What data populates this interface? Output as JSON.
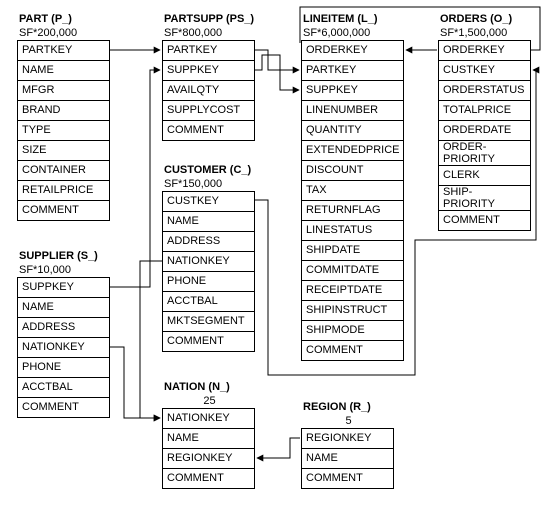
{
  "tables": {
    "part": {
      "title": "PART (P_)",
      "subtitle": "SF*200,000",
      "rows": [
        "PARTKEY",
        "NAME",
        "MFGR",
        "BRAND",
        "TYPE",
        "SIZE",
        "CONTAINER",
        "RETAILPRICE",
        "COMMENT"
      ]
    },
    "partsupp": {
      "title": "PARTSUPP (PS_)",
      "subtitle": "SF*800,000",
      "rows": [
        "PARTKEY",
        "SUPPKEY",
        "AVAILQTY",
        "SUPPLYCOST",
        "COMMENT"
      ]
    },
    "lineitem": {
      "title": "LINEITEM (L_)",
      "subtitle": "SF*6,000,000",
      "rows": [
        "ORDERKEY",
        "PARTKEY",
        "SUPPKEY",
        "LINENUMBER",
        "QUANTITY",
        "EXTENDEDPRICE",
        "DISCOUNT",
        "TAX",
        "RETURNFLAG",
        "LINESTATUS",
        "SHIPDATE",
        "COMMITDATE",
        "RECEIPTDATE",
        "SHIPINSTRUCT",
        "SHIPMODE",
        "COMMENT"
      ]
    },
    "orders": {
      "title": "ORDERS (O_)",
      "subtitle": "SF*1,500,000",
      "rows": [
        "ORDERKEY",
        "CUSTKEY",
        "ORDERSTATUS",
        "TOTALPRICE",
        "ORDERDATE",
        "ORDER-\nPRIORITY",
        "CLERK",
        "SHIP-\nPRIORITY",
        "COMMENT"
      ]
    },
    "customer": {
      "title": "CUSTOMER (C_)",
      "subtitle": "SF*150,000",
      "rows": [
        "CUSTKEY",
        "NAME",
        "ADDRESS",
        "NATIONKEY",
        "PHONE",
        "ACCTBAL",
        "MKTSEGMENT",
        "COMMENT"
      ]
    },
    "supplier": {
      "title": "SUPPLIER (S_)",
      "subtitle": "SF*10,000",
      "rows": [
        "SUPPKEY",
        "NAME",
        "ADDRESS",
        "NATIONKEY",
        "PHONE",
        "ACCTBAL",
        "COMMENT"
      ]
    },
    "nation": {
      "title": "NATION (N_)",
      "subtitle": "25",
      "rows": [
        "NATIONKEY",
        "NAME",
        "REGIONKEY",
        "COMMENT"
      ]
    },
    "region": {
      "title": "REGION (R_)",
      "subtitle": "5",
      "rows": [
        "REGIONKEY",
        "NAME",
        "COMMENT"
      ]
    }
  }
}
